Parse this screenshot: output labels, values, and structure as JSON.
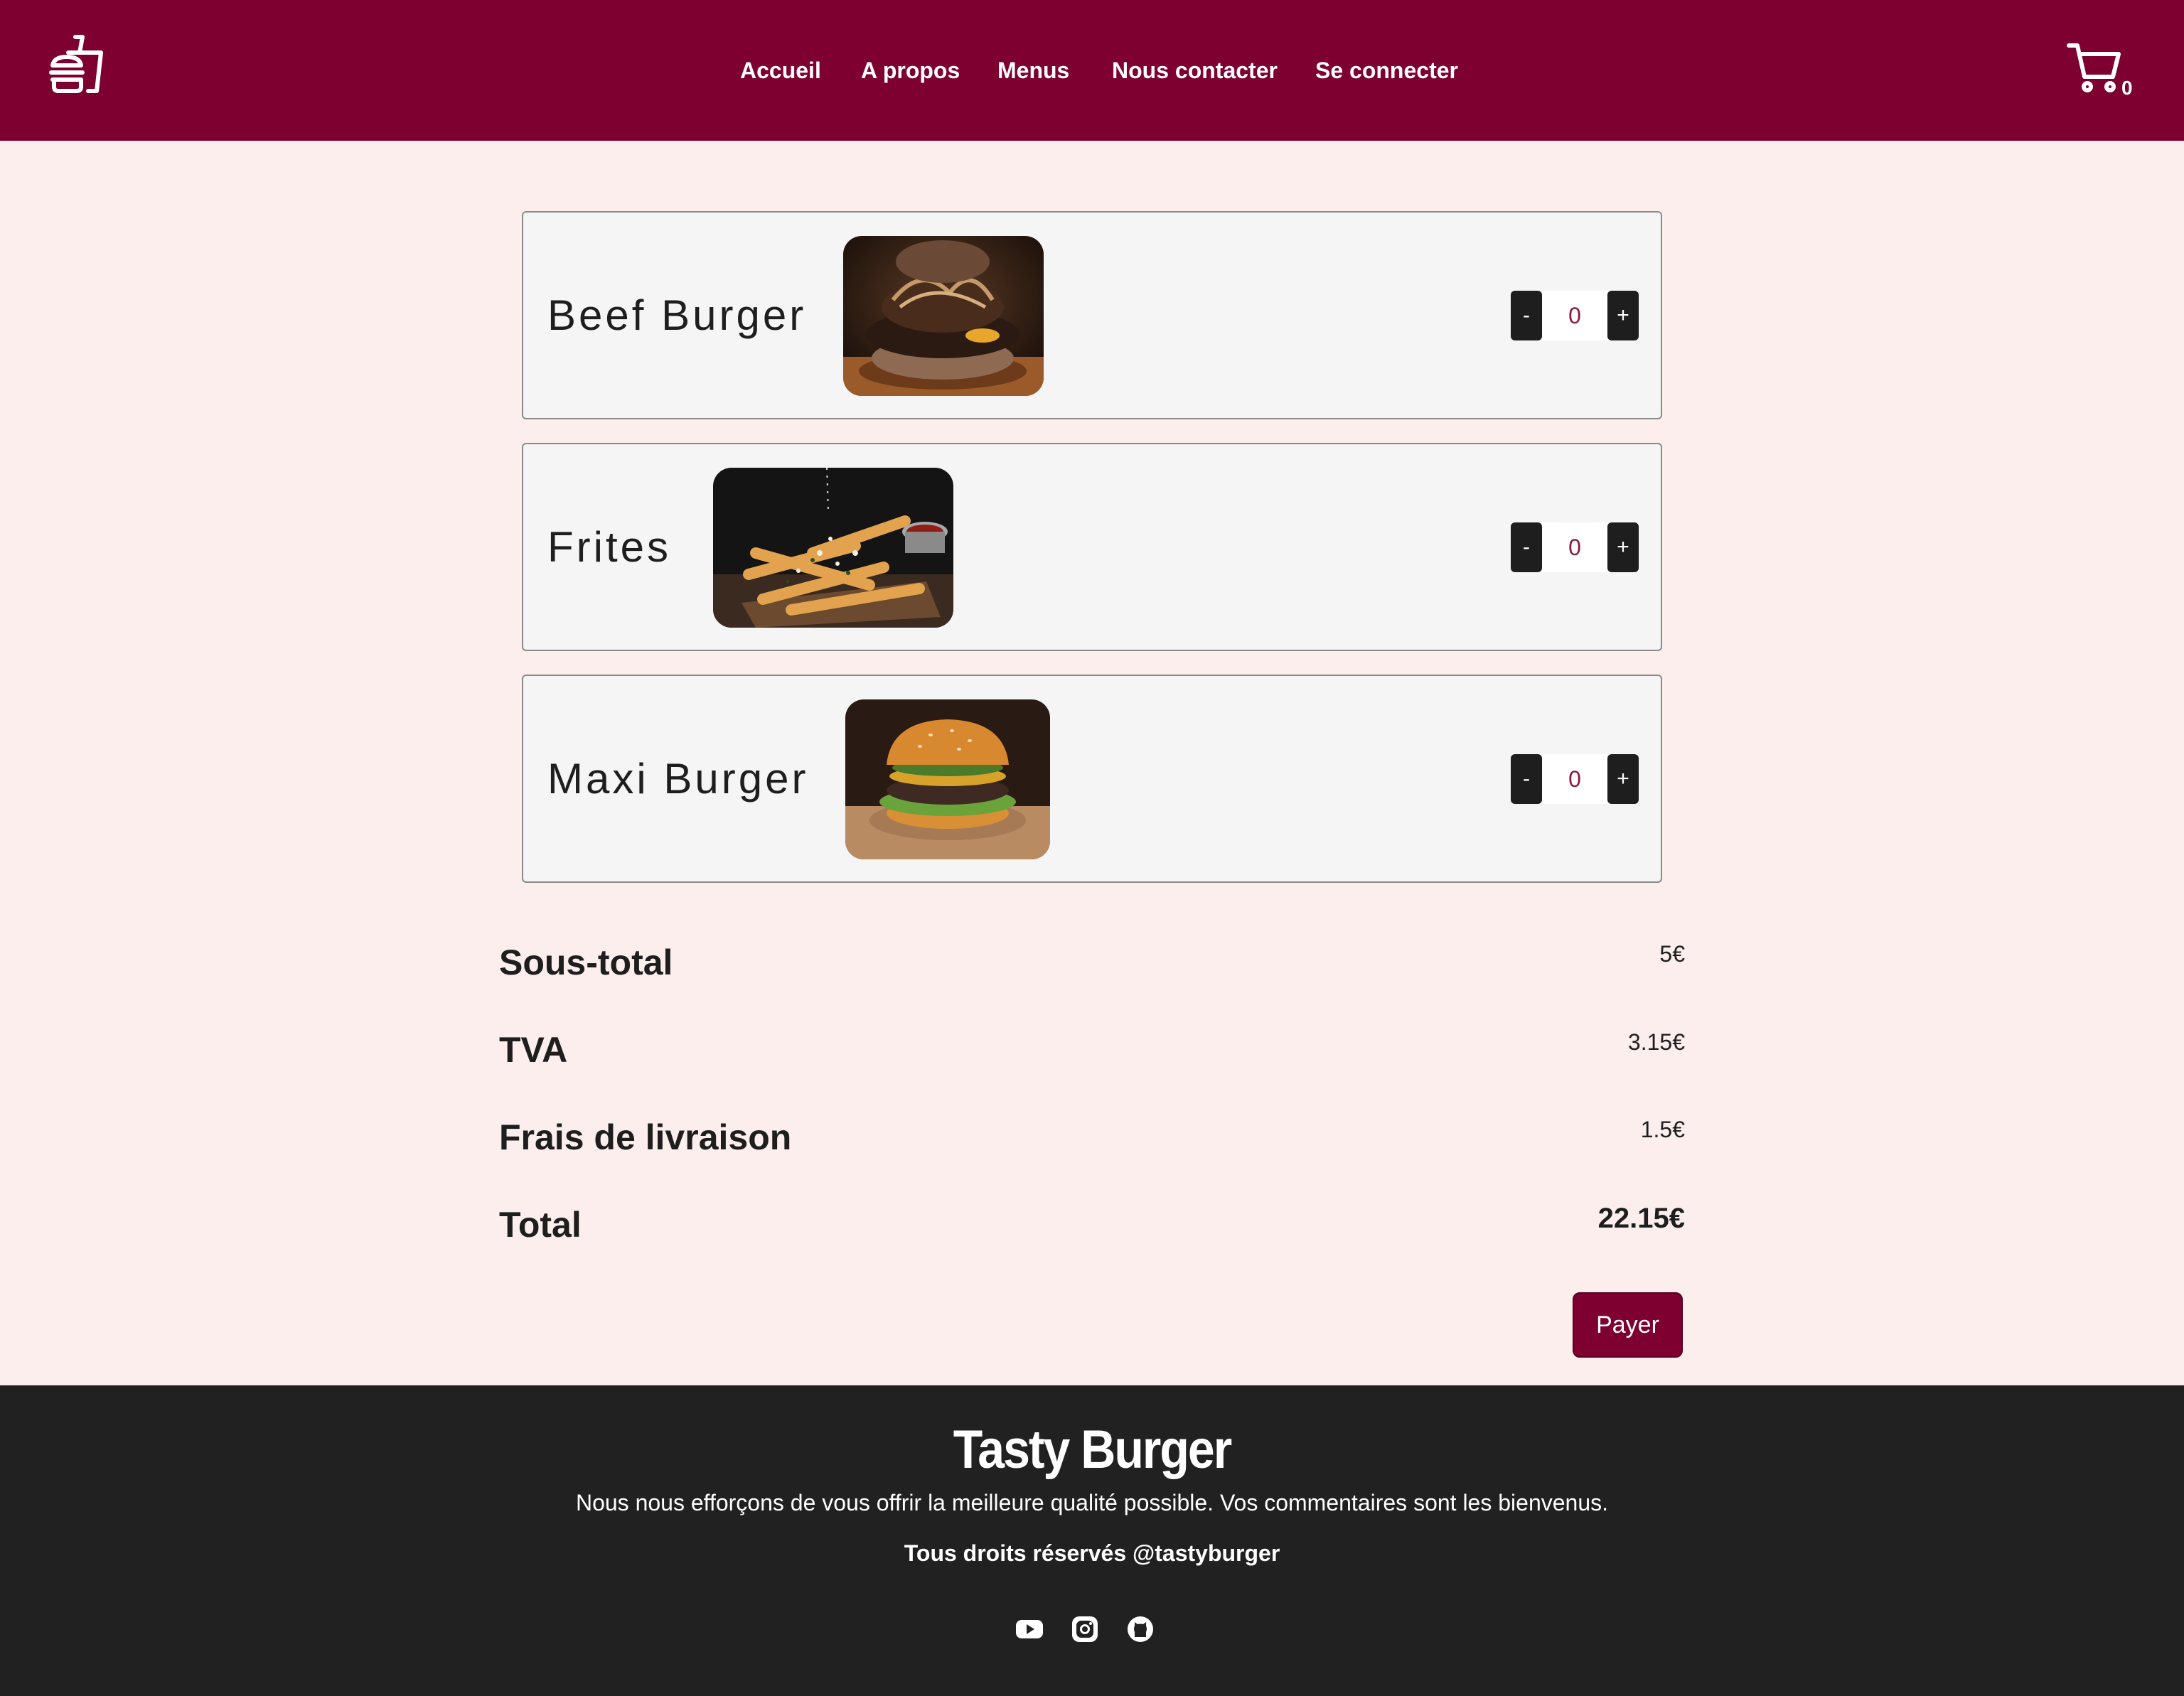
{
  "header": {
    "logo_icon": "burger-drink-logo-icon",
    "nav": [
      "Accueil",
      "A propos",
      "Menus",
      "Nous contacter",
      "Se connecter"
    ],
    "cart_icon": "shopping-cart-icon",
    "cart_count": "0"
  },
  "items": [
    {
      "name": "Beef Burger",
      "image": "beef-burger-photo",
      "quantity": "0",
      "minus": "-",
      "plus": "+"
    },
    {
      "name": "Frites",
      "image": "fries-photo",
      "quantity": "0",
      "minus": "-",
      "plus": "+"
    },
    {
      "name": "Maxi Burger",
      "image": "maxi-burger-photo",
      "quantity": "0",
      "minus": "-",
      "plus": "+"
    }
  ],
  "summary": {
    "subtotal_label": "Sous-total",
    "subtotal_value": "5€",
    "tva_label": "TVA",
    "tva_value": "3.15€",
    "delivery_label": "Frais de livraison",
    "delivery_value": "1.5€",
    "total_label": "Total",
    "total_value": "22.15€",
    "pay_label": "Payer"
  },
  "footer": {
    "brand": "Tasty Burger",
    "text": "Nous nous efforçons de vous offrir la meilleure qualité possible. Vos commentaires sont les bienvenus.",
    "rights": "Tous droits réservés @tastyburger",
    "social_icons": [
      "youtube-icon",
      "instagram-icon",
      "github-icon"
    ]
  },
  "colors": {
    "brand": "#7d0030",
    "page_background": "#fdeeee",
    "footer_background": "#212121",
    "card_background": "#f5f5f5",
    "quantity_text": "#8a1a3e"
  }
}
